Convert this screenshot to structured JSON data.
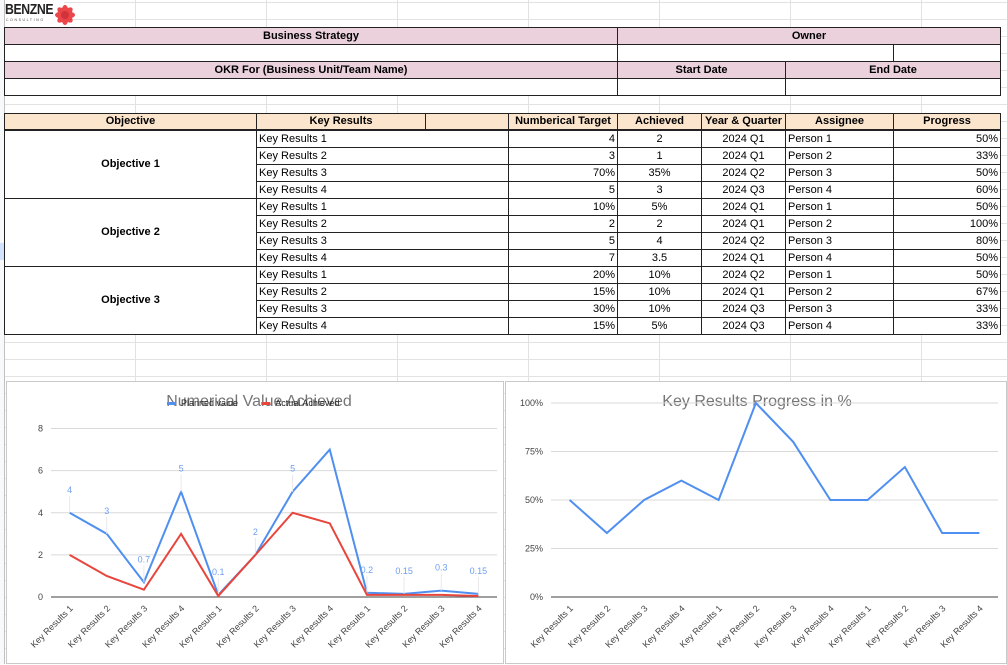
{
  "logo": {
    "name": "BENZNE",
    "tagline": "CONSULTING",
    "mark_color": "#e8262b"
  },
  "header": {
    "business_strategy_label": "Business Strategy",
    "owner_label": "Owner",
    "okr_for_label": "OKR For (Business Unit/Team Name)",
    "start_date_label": "Start Date",
    "end_date_label": "End Date",
    "business_strategy_value": "",
    "owner_value": "",
    "okr_for_value": "",
    "start_date_value": "",
    "end_date_value": ""
  },
  "table": {
    "columns": [
      "Objective",
      "Key Results",
      "Numberical Target",
      "Achieved",
      "Year & Quarter",
      "Assignee",
      "Progress"
    ],
    "objectives": [
      {
        "name": "Objective 1",
        "rows": [
          {
            "kr": "Key Results 1",
            "target": "4",
            "achieved": "2",
            "quarter": "2024 Q1",
            "assignee": "Person 1",
            "progress": "50%"
          },
          {
            "kr": "Key Results 2",
            "target": "3",
            "achieved": "1",
            "quarter": "2024 Q1",
            "assignee": "Person 2",
            "progress": "33%"
          },
          {
            "kr": "Key Results 3",
            "target": "70%",
            "achieved": "35%",
            "quarter": "2024 Q2",
            "assignee": "Person 3",
            "progress": "50%"
          },
          {
            "kr": "Key Results 4",
            "target": "5",
            "achieved": "3",
            "quarter": "2024 Q3",
            "assignee": "Person 4",
            "progress": "60%"
          }
        ]
      },
      {
        "name": "Objective 2",
        "rows": [
          {
            "kr": "Key Results 1",
            "target": "10%",
            "achieved": "5%",
            "quarter": "2024 Q1",
            "assignee": "Person 1",
            "progress": "50%"
          },
          {
            "kr": "Key Results 2",
            "target": "2",
            "achieved": "2",
            "quarter": "2024 Q1",
            "assignee": "Person 2",
            "progress": "100%"
          },
          {
            "kr": "Key Results 3",
            "target": "5",
            "achieved": "4",
            "quarter": "2024 Q2",
            "assignee": "Person 3",
            "progress": "80%"
          },
          {
            "kr": "Key Results 4",
            "target": "7",
            "achieved": "3.5",
            "quarter": "2024 Q1",
            "assignee": "Person 4",
            "progress": "50%"
          }
        ]
      },
      {
        "name": "Objective 3",
        "rows": [
          {
            "kr": "Key Results 1",
            "target": "20%",
            "achieved": "10%",
            "quarter": "2024 Q2",
            "assignee": "Person 1",
            "progress": "50%"
          },
          {
            "kr": "Key Results 2",
            "target": "15%",
            "achieved": "10%",
            "quarter": "2024 Q1",
            "assignee": "Person 2",
            "progress": "67%"
          },
          {
            "kr": "Key Results 3",
            "target": "30%",
            "achieved": "10%",
            "quarter": "2024 Q3",
            "assignee": "Person 3",
            "progress": "33%"
          },
          {
            "kr": "Key Results 4",
            "target": "15%",
            "achieved": "5%",
            "quarter": "2024 Q3",
            "assignee": "Person 4",
            "progress": "33%"
          }
        ]
      }
    ]
  },
  "colors": {
    "header_pink": "#ead1dc",
    "header_peach": "#fce5cd",
    "planned_blue": "#4f8ff0",
    "actual_red": "#e8453c",
    "datalabel_blue": "#6fa0f0"
  },
  "chart_data": [
    {
      "type": "line",
      "title": "Numerical Value Achieved",
      "categories": [
        "Key Results 1",
        "Key Results 2",
        "Key Results 3",
        "Key Results 4",
        "Key Results 1",
        "Key Results 2",
        "Key Results 3",
        "Key Results 4",
        "Key Results 1",
        "Key Results 2",
        "Key Results 3",
        "Key Results 4"
      ],
      "series": [
        {
          "name": "Planned value",
          "color": "#4f8ff0",
          "values": [
            4,
            3,
            0.7,
            5,
            0.1,
            2,
            5,
            7,
            0.2,
            0.15,
            0.3,
            0.15
          ],
          "data_labels": [
            "4",
            "3",
            "0.7",
            "5",
            "0.1",
            "2",
            "5",
            "",
            "0.2",
            "0.15",
            "0.3",
            "0.15"
          ]
        },
        {
          "name": "Actual Achieved",
          "color": "#e8453c",
          "values": [
            2,
            1,
            0.35,
            3,
            0.05,
            2,
            4,
            3.5,
            0.1,
            0.1,
            0.1,
            0.05
          ]
        }
      ],
      "yticks": [
        "0",
        "2",
        "4",
        "6",
        "8"
      ],
      "ylim": [
        0,
        8.5
      ],
      "xlabel": "",
      "ylabel": "",
      "legend": "top",
      "grid": true
    },
    {
      "type": "line",
      "title": "Key Results Progress in %",
      "categories": [
        "Key Results 1",
        "Key Results 2",
        "Key Results 3",
        "Key Results 4",
        "Key Results 1",
        "Key Results 2",
        "Key Results 3",
        "Key Results 4",
        "Key Results 1",
        "Key Results 2",
        "Key Results 3",
        "Key Results 4"
      ],
      "series": [
        {
          "name": "Progress",
          "color": "#4f8ff0",
          "values": [
            50,
            33,
            50,
            60,
            50,
            100,
            80,
            50,
            50,
            67,
            33,
            33
          ]
        }
      ],
      "yticks": [
        "0%",
        "25%",
        "50%",
        "75%",
        "100%"
      ],
      "ylim": [
        0,
        100
      ],
      "xlabel": "",
      "ylabel": "",
      "legend": "none",
      "grid": true
    }
  ]
}
